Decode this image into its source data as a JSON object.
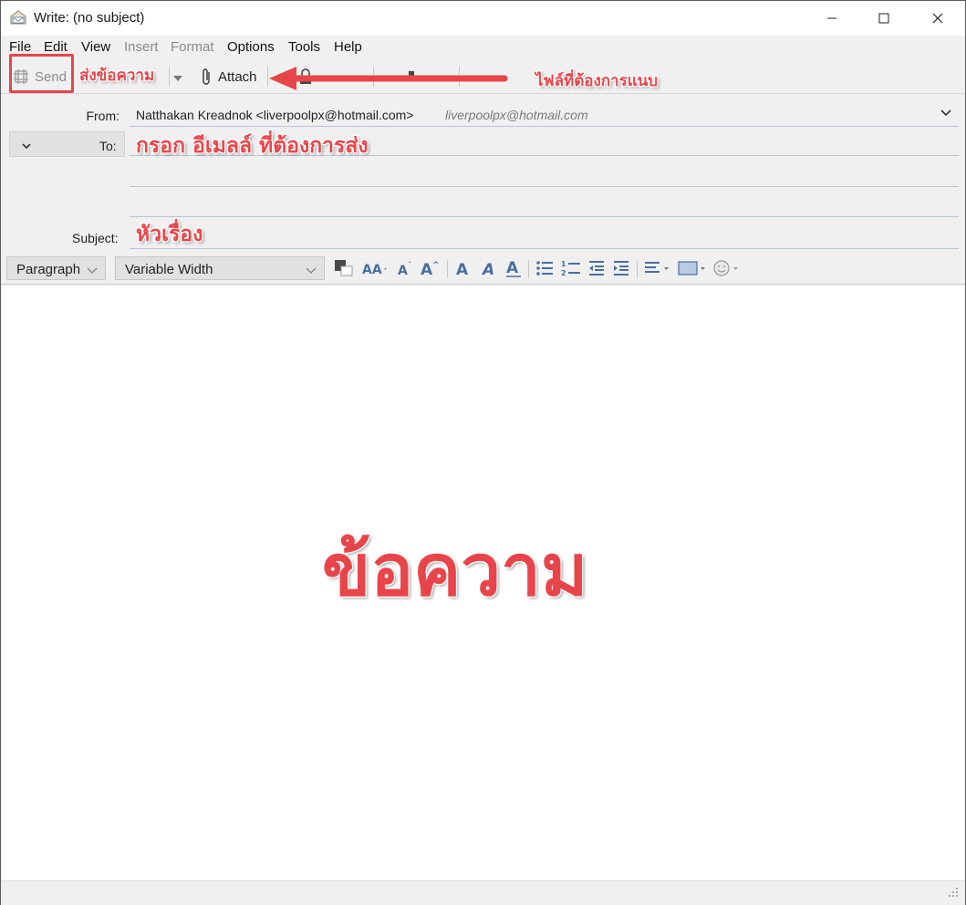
{
  "window": {
    "title": "Write: (no subject)"
  },
  "menu": {
    "file": "File",
    "edit": "Edit",
    "view": "View",
    "insert": "Insert",
    "format": "Format",
    "options": "Options",
    "tools": "Tools",
    "help": "Help"
  },
  "toolbar": {
    "send_label": "Send",
    "attach_label": "Attach"
  },
  "headers": {
    "from_label": "From:",
    "from_value": "Natthakan Kreadnok <liverpoolpx@hotmail.com>",
    "from_identity": "liverpoolpx@hotmail.com",
    "to_label": "To:",
    "to_value": "",
    "subject_label": "Subject:",
    "subject_value": ""
  },
  "format_bar": {
    "paragraph_select": "Paragraph",
    "font_select": "Variable Width"
  },
  "annotations": {
    "send_note": "ส่งข้อความ",
    "attach_note": "ไฟล์ที่ต้องการแนบ",
    "to_note": "กรอก อีเมลล์ ที่ต้องการส่ง",
    "subject_note": "หัวเรื่อง",
    "body_note": "ข้อความ"
  },
  "colors": {
    "annotation": "#e8454a",
    "chrome": "#f0f0f0",
    "header_line": "#b8c4d8",
    "format_icon": "#4a6ea0"
  }
}
